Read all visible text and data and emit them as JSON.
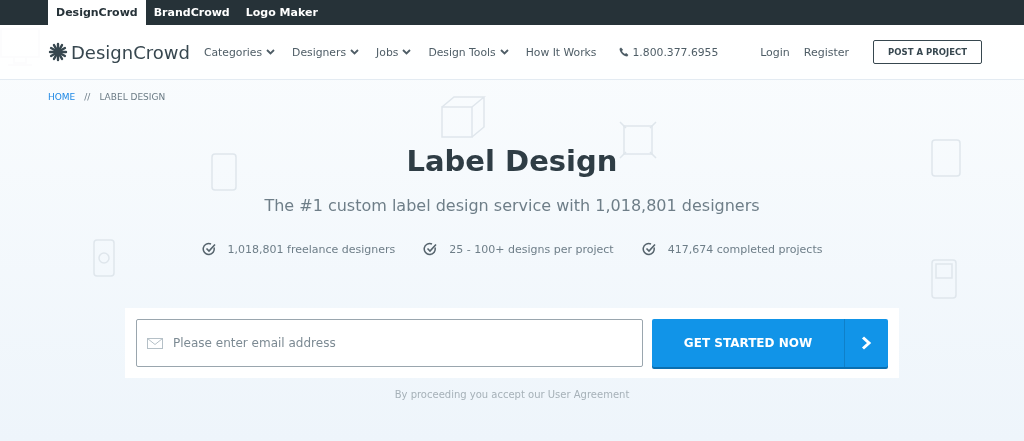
{
  "top_tabs": [
    {
      "label": "DesignCrowd",
      "selected": true
    },
    {
      "label": "BrandCrowd",
      "selected": false
    },
    {
      "label": "Logo Maker",
      "selected": false
    }
  ],
  "header": {
    "logo": "DesignCrowd",
    "nav": [
      {
        "label": "Categories",
        "dropdown": true
      },
      {
        "label": "Designers",
        "dropdown": true
      },
      {
        "label": "Jobs",
        "dropdown": true
      },
      {
        "label": "Design Tools",
        "dropdown": true
      },
      {
        "label": "How It Works",
        "dropdown": false
      }
    ],
    "phone": "1.800.377.6955",
    "login": "Login",
    "register": "Register",
    "post_button": "POST A PROJECT"
  },
  "breadcrumb": [
    {
      "label": "HOME",
      "link": true
    },
    {
      "label": "//",
      "link": false
    },
    {
      "label": "LABEL DESIGN",
      "link": false
    }
  ],
  "hero": {
    "title": "Label Design",
    "subtitle": "The #1 custom label design service with 1,018,801 designers",
    "features": [
      "1,018,801 freelance designers",
      "25 - 100+ designs per project",
      "417,674 completed projects"
    ]
  },
  "signup": {
    "placeholder": "Please enter email address",
    "button": "GET STARTED NOW",
    "note": "By proceeding you accept our User Agreement"
  }
}
